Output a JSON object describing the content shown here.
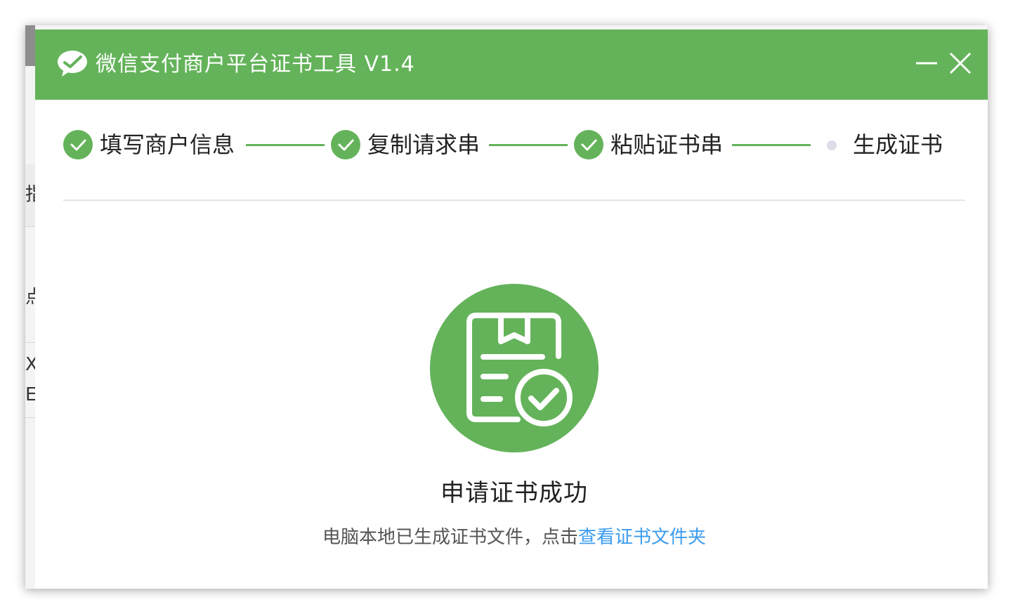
{
  "window": {
    "title": "微信支付商户平台证书工具 V1.4",
    "minimize_icon": "minimize-icon",
    "close_icon": "close-icon"
  },
  "background_window": {
    "peek_texts": [
      "指",
      "点",
      "X",
      "EN"
    ]
  },
  "steps": [
    {
      "label": "填写商户信息",
      "status": "done"
    },
    {
      "label": "复制请求串",
      "status": "done"
    },
    {
      "label": "粘贴证书串",
      "status": "done"
    },
    {
      "label": "生成证书",
      "status": "current"
    }
  ],
  "result": {
    "icon": "certificate-success-icon",
    "title": "申请证书成功",
    "desc_prefix": "电脑本地已生成证书文件，点击",
    "link_label": "查看证书文件夹"
  },
  "colors": {
    "brand_green": "#64b35a",
    "link_blue": "#3b9cf0",
    "pending_dot": "#dcdde6"
  }
}
